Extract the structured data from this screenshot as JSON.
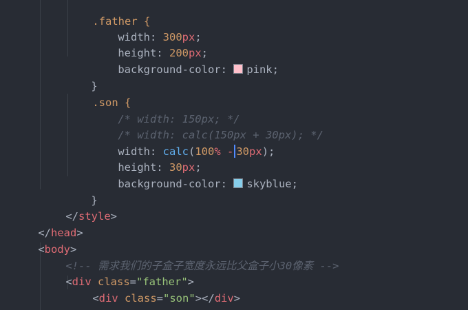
{
  "code": {
    "father_selector": ".father {",
    "father_width_prop": "width: ",
    "father_width_num": "300",
    "father_width_unit": "px",
    "father_height_prop": "height: ",
    "father_height_num": "200",
    "father_height_unit": "px",
    "father_bg_prop": "background-color: ",
    "father_bg_value": "pink",
    "father_bg_color": "#ffc0cb",
    "close_brace": "}",
    "son_selector": ".son {",
    "comment_width_150": "/* width: 150px; */",
    "comment_width_calc": "/* width: calc(150px + 30px); */",
    "son_width_prop": "width: ",
    "son_width_fn": "calc",
    "son_width_paren_open": "(",
    "son_width_num1": "100",
    "son_width_pct": "%",
    "son_width_minus": " -",
    "son_width_num2": "30",
    "son_width_unit": "px",
    "son_width_paren_close": ");",
    "son_height_prop": "height: ",
    "son_height_num": "30",
    "son_height_unit": "px",
    "son_bg_prop": "background-color: ",
    "son_bg_value": "skyblue",
    "son_bg_color": "#87ceeb",
    "semicolon": ";",
    "style_close_open": "</",
    "style_close_tag": "style",
    "style_close_end": ">",
    "head_close_open": "</",
    "head_close_tag": "head",
    "head_close_end": ">",
    "body_open": "<",
    "body_tag": "body",
    "body_end": ">",
    "html_comment": "<!-- 需求我们的子盒子宽度永远比父盒子小30像素 -->",
    "div_open": "<",
    "div_tag": "div",
    "class_attr": " class",
    "equals": "=",
    "father_class_value": "\"father\"",
    "tag_end": ">",
    "son_class_value": "\"son\"",
    "div_close_tag": "</div>",
    "div_close_open": "</",
    "div_close_end": ">"
  },
  "colors": {
    "background": "#282c34",
    "selector": "#d19a66",
    "number": "#d19a66",
    "unit": "#e06c75",
    "function": "#61afef",
    "comment": "#5c6370",
    "tag": "#e06c75",
    "string": "#98c379",
    "cursor": "#528bff"
  }
}
